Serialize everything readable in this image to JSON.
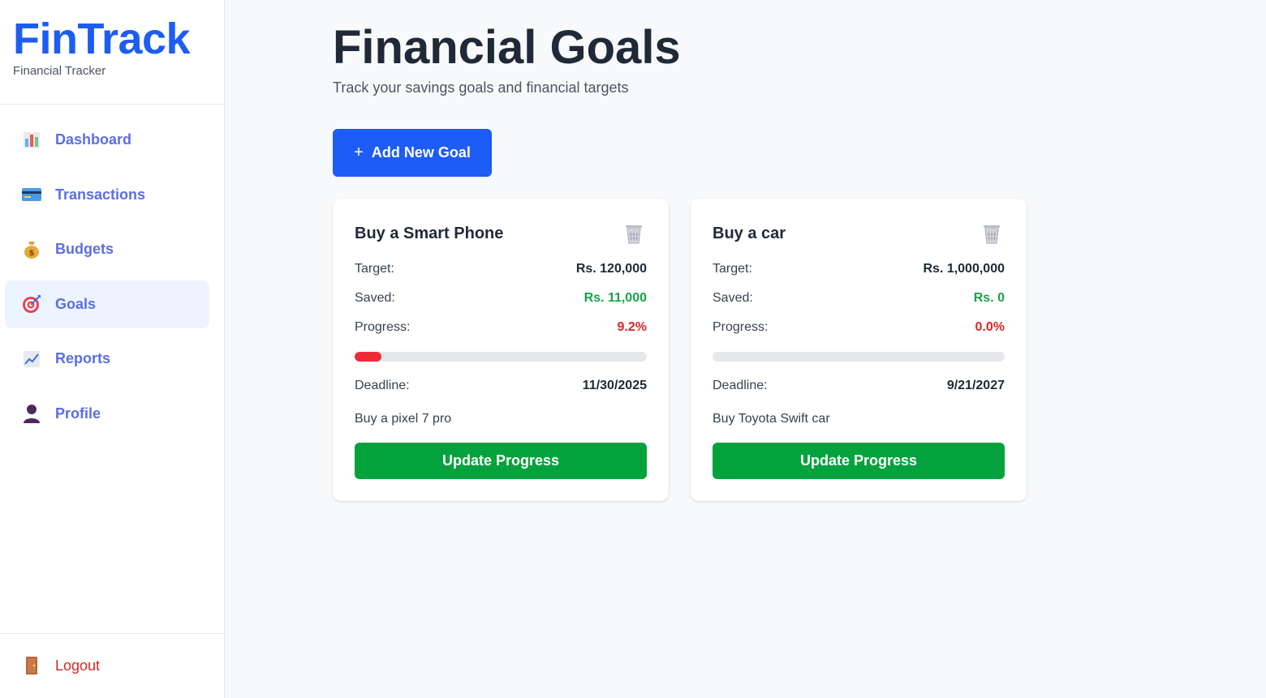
{
  "brand": {
    "title": "FinTrack",
    "subtitle": "Financial Tracker"
  },
  "sidebar": {
    "items": [
      {
        "label": "Dashboard",
        "icon": "bar-chart-icon",
        "active": false
      },
      {
        "label": "Transactions",
        "icon": "credit-card-icon",
        "active": false
      },
      {
        "label": "Budgets",
        "icon": "money-bag-icon",
        "active": false
      },
      {
        "label": "Goals",
        "icon": "target-icon",
        "active": true
      },
      {
        "label": "Reports",
        "icon": "line-chart-icon",
        "active": false
      },
      {
        "label": "Profile",
        "icon": "user-icon",
        "active": false
      }
    ],
    "logout": {
      "label": "Logout",
      "icon": "door-icon"
    }
  },
  "page": {
    "title": "Financial Goals",
    "subtitle": "Track your savings goals and financial targets",
    "add_button": {
      "plus": "+",
      "label": "Add New Goal"
    }
  },
  "goals": [
    {
      "title": "Buy a Smart Phone",
      "target_label": "Target:",
      "target": "Rs. 120,000",
      "saved_label": "Saved:",
      "saved": "Rs. 11,000",
      "progress_label": "Progress:",
      "progress": "9.2%",
      "progress_fraction": 0.092,
      "deadline_label": "Deadline:",
      "deadline": "11/30/2025",
      "description": "Buy a pixel 7 pro",
      "update_label": "Update Progress"
    },
    {
      "title": "Buy a car",
      "target_label": "Target:",
      "target": "Rs. 1,000,000",
      "saved_label": "Saved:",
      "saved": "Rs. 0",
      "progress_label": "Progress:",
      "progress": "0.0%",
      "progress_fraction": 0.0,
      "deadline_label": "Deadline:",
      "deadline": "9/21/2027",
      "description": "Buy Toyota Swift car",
      "update_label": "Update Progress"
    }
  ],
  "colors": {
    "brand": "#1d5cf5",
    "nav_text": "#5b6ee1",
    "active_bg": "#eef4ff",
    "saved_green": "#16a34a",
    "progress_red": "#dc2626",
    "bar_fill": "#ef2b3a",
    "update_button": "#04a23d",
    "logout": "#dc2626"
  }
}
